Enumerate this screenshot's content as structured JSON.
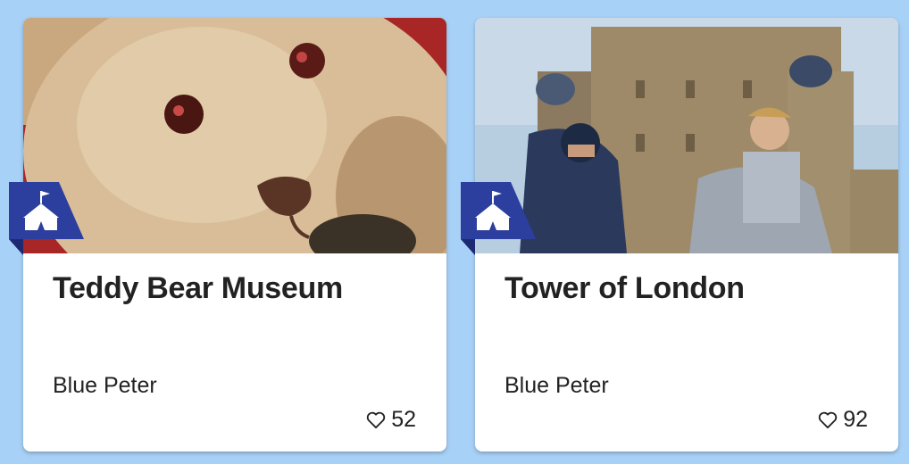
{
  "cards": [
    {
      "title": "Teddy Bear Museum",
      "channel": "Blue Peter",
      "likes": "52",
      "image": "teddy-bear-photo",
      "badge_icon": "tent-icon"
    },
    {
      "title": "Tower of London",
      "channel": "Blue Peter",
      "likes": "92",
      "image": "tower-of-london-photo",
      "badge_icon": "tent-icon"
    }
  ],
  "colors": {
    "background": "#a8d1f7",
    "card": "#ffffff",
    "badge": "#2c3e9e",
    "text": "#222222"
  }
}
